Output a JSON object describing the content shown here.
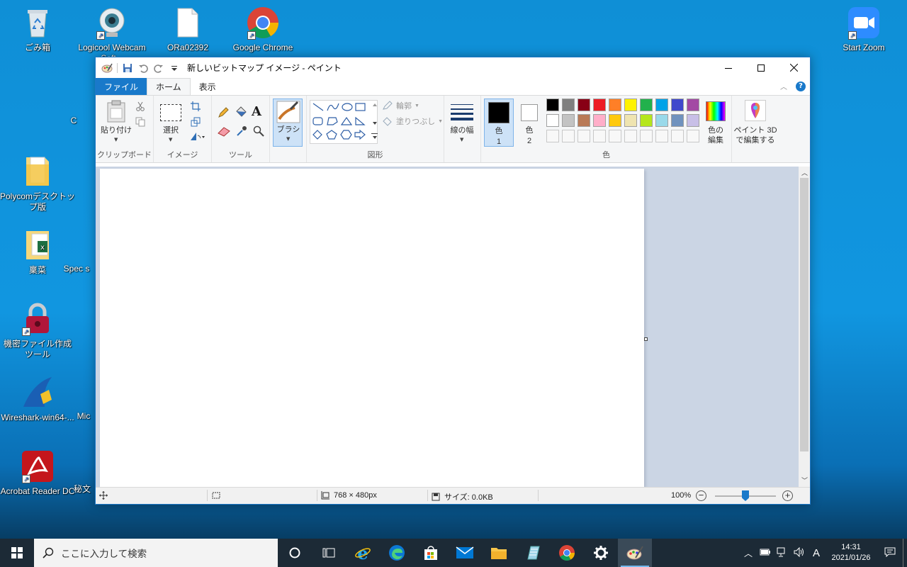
{
  "desktop": {
    "icons": [
      {
        "label": "ごみ箱"
      },
      {
        "label": "Logicool Webcam Soft..."
      },
      {
        "label": "ORa02392"
      },
      {
        "label": "Google Chrome"
      },
      {
        "label": "Start Zoom"
      },
      {
        "label": "Polycomデスクトップ版"
      },
      {
        "label": "稟菜"
      },
      {
        "label": "機密ファイル作成ツール"
      },
      {
        "label": "Wireshark-win64-..."
      },
      {
        "label": "Acrobat Reader DC"
      }
    ],
    "partial_labels": [
      "C",
      "Spec s",
      "Mic",
      "秘文"
    ]
  },
  "window": {
    "title": "新しいビットマップ イメージ - ペイント",
    "tabs": [
      "ファイル",
      "ホーム",
      "表示"
    ],
    "active_tab": "ホーム"
  },
  "ribbon": {
    "clipboard": {
      "paste": "貼り付け",
      "group": "クリップボード"
    },
    "image": {
      "select": "選択",
      "group": "イメージ"
    },
    "tools": {
      "group": "ツール"
    },
    "brush": {
      "label": "ブラシ"
    },
    "shapes": {
      "outline": "輪郭",
      "fill": "塗りつぶし",
      "group": "図形"
    },
    "size": {
      "label": "線の幅"
    },
    "color1": {
      "label_top": "色",
      "label_bottom": "1",
      "value": "#000000"
    },
    "color2": {
      "label_top": "色",
      "label_bottom": "2",
      "value": "#ffffff"
    },
    "colors_group": "色",
    "edit_colors": {
      "line1": "色の",
      "line2": "編集"
    },
    "paint3d": {
      "line1": "ペイント 3D",
      "line2": "で編集する"
    },
    "palette_row1": [
      "#000000",
      "#7f7f7f",
      "#880015",
      "#ed1c24",
      "#ff7f27",
      "#fff200",
      "#22b14c",
      "#00a2e8",
      "#3f48cc",
      "#a349a4"
    ],
    "palette_row2": [
      "#ffffff",
      "#c3c3c3",
      "#b97a57",
      "#ffaec9",
      "#ffc90e",
      "#efe4b0",
      "#b5e61d",
      "#99d9ea",
      "#7092be",
      "#c8bfe7"
    ]
  },
  "statusbar": {
    "dimensions": "768 × 480px",
    "size": "サイズ: 0.0KB",
    "zoom": "100%",
    "zoom_level_percent": 100
  },
  "taskbar": {
    "search_placeholder": "ここに入力して検索",
    "time": "14:31",
    "date": "2021/01/26",
    "ime": "A"
  }
}
